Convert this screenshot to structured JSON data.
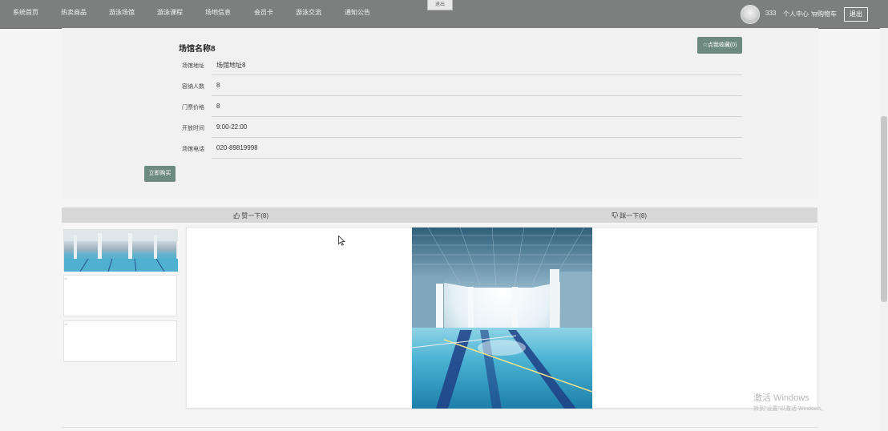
{
  "nav": {
    "items": [
      "系统首页",
      "热卖商品",
      "游泳场馆",
      "游泳课程",
      "场地信息",
      "会员卡",
      "游泳交流",
      "通知公告"
    ],
    "center_tab": "退出",
    "username": "333",
    "profile": "个人中心",
    "cart": "购物车",
    "logout": "退出"
  },
  "venue": {
    "title": "场馆名称8",
    "favorite": "☆点我收藏(0)",
    "rows": [
      {
        "label": "场馆地址",
        "value": "场馆地址8"
      },
      {
        "label": "容纳人数",
        "value": "8"
      },
      {
        "label": "门票价格",
        "value": "8"
      },
      {
        "label": "开放时间",
        "value": "9:00-22:00"
      },
      {
        "label": "场馆电话",
        "value": "020-89819998"
      }
    ],
    "buy": "立即购买"
  },
  "vote": {
    "like": "赞一下(8)",
    "dislike": "踩一下(8)"
  },
  "watermark": {
    "line1": "激活 Windows",
    "line2": "转到\"设置\"以激活 Windows。"
  },
  "icons": {
    "like": "thumbs-up-icon",
    "dislike": "thumbs-down-icon",
    "cart": "cart-icon",
    "cursor": "mouse-pointer-icon"
  }
}
